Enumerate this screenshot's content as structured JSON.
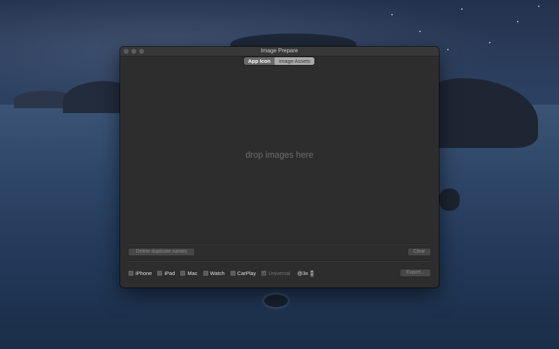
{
  "window": {
    "title": "Image Prepare",
    "tabs": [
      {
        "label": "App Icon",
        "active": true
      },
      {
        "label": "Image Assets",
        "active": false
      }
    ],
    "dropzone_text": "drop images here",
    "buttons": {
      "delete_duplicates": "Delete duplicate names",
      "clear": "Clear",
      "export": "Export..."
    },
    "options": [
      {
        "label": "iPhone",
        "checked": false,
        "enabled": true
      },
      {
        "label": "iPad",
        "checked": false,
        "enabled": true
      },
      {
        "label": "Mac",
        "checked": false,
        "enabled": true
      },
      {
        "label": "Watch",
        "checked": false,
        "enabled": true
      },
      {
        "label": "CarPlay",
        "checked": false,
        "enabled": true
      },
      {
        "label": "Universal",
        "checked": true,
        "enabled": false
      }
    ],
    "scale_value": "@3x"
  },
  "icons": {
    "close": "close-icon",
    "minimize": "minimize-icon",
    "zoom": "zoom-icon",
    "checkmark": "checkmark-icon",
    "stepper": "stepper-icon"
  },
  "colors": {
    "window_bg": "#2d2d2d",
    "titlebar_bg": "#383838",
    "segment_active": "#6a6a6a",
    "segment_inactive": "#a9a9a9"
  }
}
